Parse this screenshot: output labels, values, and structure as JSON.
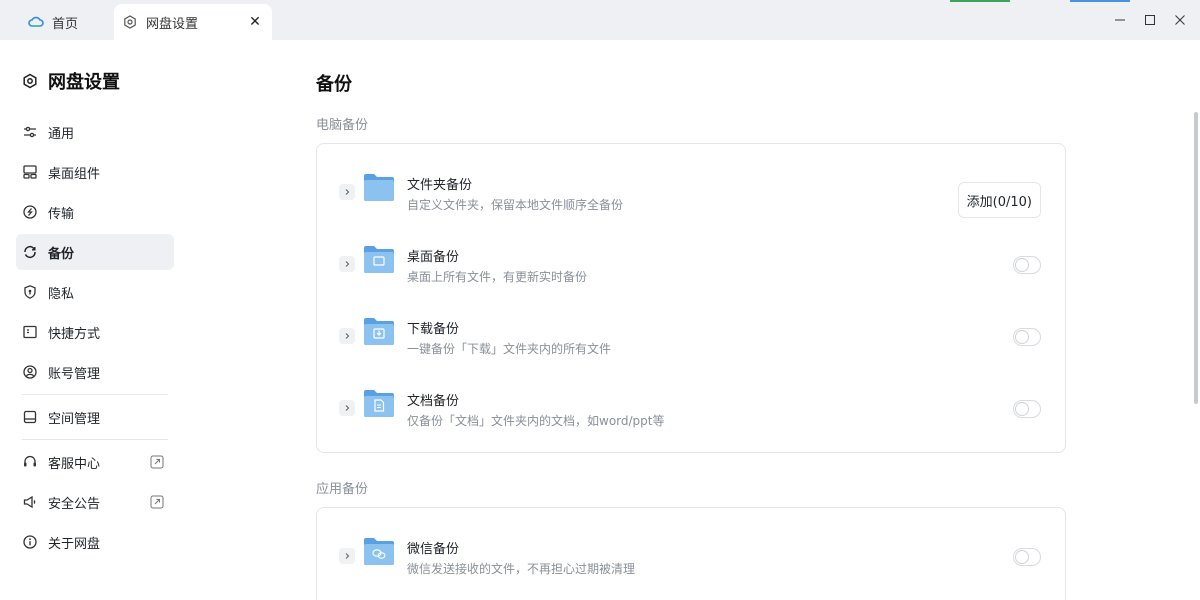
{
  "titlebar": {
    "tabs": [
      {
        "label": "首页",
        "icon": "cloud-icon"
      },
      {
        "label": "网盘设置",
        "icon": "settings-hex-icon"
      }
    ],
    "close_symbol": "✕"
  },
  "sidebar": {
    "title": "网盘设置",
    "items": [
      {
        "label": "通用",
        "icon": "sliders-icon"
      },
      {
        "label": "桌面组件",
        "icon": "widget-icon"
      },
      {
        "label": "传输",
        "icon": "transfer-icon"
      },
      {
        "label": "备份",
        "icon": "backup-icon",
        "active": true
      },
      {
        "label": "隐私",
        "icon": "shield-icon"
      },
      {
        "label": "快捷方式",
        "icon": "shortcut-icon"
      },
      {
        "label": "账号管理",
        "icon": "account-icon"
      },
      {
        "label": "空间管理",
        "icon": "storage-icon"
      },
      {
        "label": "客服中心",
        "icon": "headset-icon",
        "external": true
      },
      {
        "label": "安全公告",
        "icon": "announce-icon",
        "external": true
      },
      {
        "label": "关于网盘",
        "icon": "info-icon"
      }
    ]
  },
  "content": {
    "title": "备份",
    "sections": [
      {
        "label": "电脑备份",
        "rows": [
          {
            "title": "文件夹备份",
            "desc": "自定义文件夹，保留本地文件顺序全备份",
            "action": "button",
            "action_label": "添加(0/10)",
            "folder_icon": "folder-icon"
          },
          {
            "title": "桌面备份",
            "desc": "桌面上所有文件，有更新实时备份",
            "action": "toggle",
            "enabled": false,
            "folder_icon": "desktop-folder-icon"
          },
          {
            "title": "下载备份",
            "desc": "一键备份「下载」文件夹内的所有文件",
            "action": "toggle",
            "enabled": false,
            "folder_icon": "download-folder-icon"
          },
          {
            "title": "文档备份",
            "desc": "仅备份「文档」文件夹内的文档，如word/ppt等",
            "action": "toggle",
            "enabled": false,
            "folder_icon": "document-folder-icon"
          }
        ]
      },
      {
        "label": "应用备份",
        "rows": [
          {
            "title": "微信备份",
            "desc": "微信发送接收的文件，不再担心过期被清理",
            "action": "toggle",
            "enabled": false,
            "folder_icon": "wechat-folder-icon"
          }
        ]
      }
    ]
  },
  "colors": {
    "folder": "#7fb8ec",
    "folder_back": "#5aa1e3",
    "active_bg": "#eef0f3",
    "desc_text": "#8a8f99"
  }
}
